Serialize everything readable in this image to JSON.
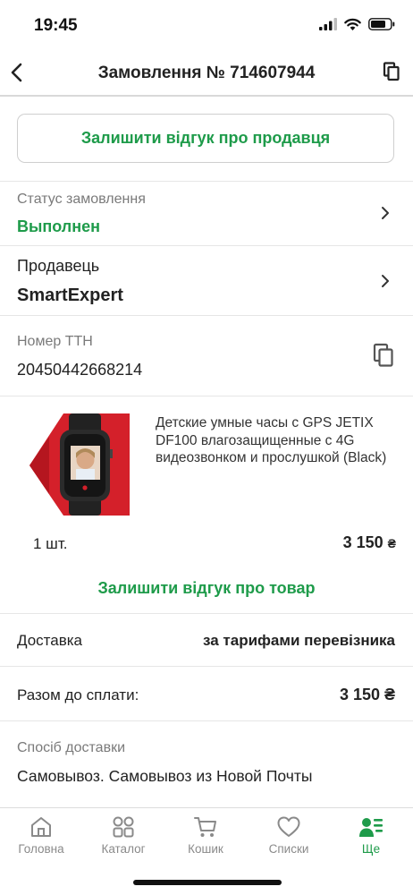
{
  "status_bar": {
    "time": "19:45"
  },
  "header": {
    "title": "Замовлення № 714607944"
  },
  "seller_review_button": "Залишити відгук про продавця",
  "order_status": {
    "label": "Статус замовлення",
    "value": "Выполнен"
  },
  "seller": {
    "label": "Продавець",
    "value": "SmartExpert"
  },
  "ttn": {
    "label": "Номер ТТН",
    "value": "20450442668214"
  },
  "product": {
    "title": "Детские умные часы с GPS JETIX DF100 влагозащищенные с 4G видеозвонком и прослушкой (Black)",
    "quantity": "1 шт.",
    "price": "3 150",
    "currency": "₴",
    "review_button": "Залишити відгук про товар"
  },
  "delivery": {
    "label": "Доставка",
    "value": "за тарифами перевізника"
  },
  "total": {
    "label": "Разом до сплати:",
    "value": "3 150 ₴"
  },
  "delivery_method": {
    "label": "Спосіб доставки",
    "value": "Самовывоз. Самовывоз из Новой Почты"
  },
  "tabbar": {
    "items": [
      {
        "label": "Головна",
        "icon": "home-icon"
      },
      {
        "label": "Каталог",
        "icon": "catalog-icon"
      },
      {
        "label": "Кошик",
        "icon": "cart-icon"
      },
      {
        "label": "Списки",
        "icon": "heart-icon"
      },
      {
        "label": "Ще",
        "icon": "profile-menu-icon"
      }
    ],
    "active_index": 4
  },
  "colors": {
    "accent_green": "#1e9b4a",
    "product_red": "#d4202a"
  }
}
